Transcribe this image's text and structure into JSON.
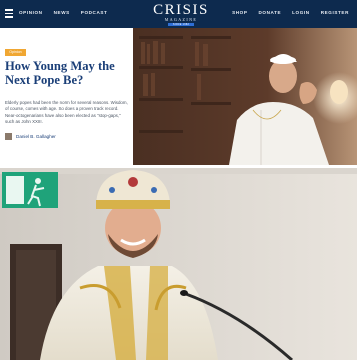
{
  "header": {
    "nav_left": [
      "OPINION",
      "NEWS",
      "PODCAST"
    ],
    "nav_right": [
      "SHOP",
      "DONATE",
      "LOGIN",
      "REGISTER"
    ],
    "logo_title": "CRISIS",
    "logo_subtitle": "MAGAZINE",
    "logo_tag": "SINCE 1982"
  },
  "article": {
    "category": "Opinion",
    "headline": "How Young May the Next Pope Be?",
    "excerpt": "Elderly popes had been the norm for several reasons. Wisdom, of course, comes with age. So does a proven track record. Near-octogenarians have also been elected as \"stop-gaps,\" such as John XXIII.",
    "author": "Daniel B. Gallagher"
  },
  "colors": {
    "nav_background": "#0d2a4e",
    "headline": "#1b3f78",
    "category_badge": "#f0a733",
    "exit_sign": "#1fa37a"
  },
  "icons": {
    "menu": "hamburger-icon",
    "exit_sign": "emergency-exit-icon"
  }
}
